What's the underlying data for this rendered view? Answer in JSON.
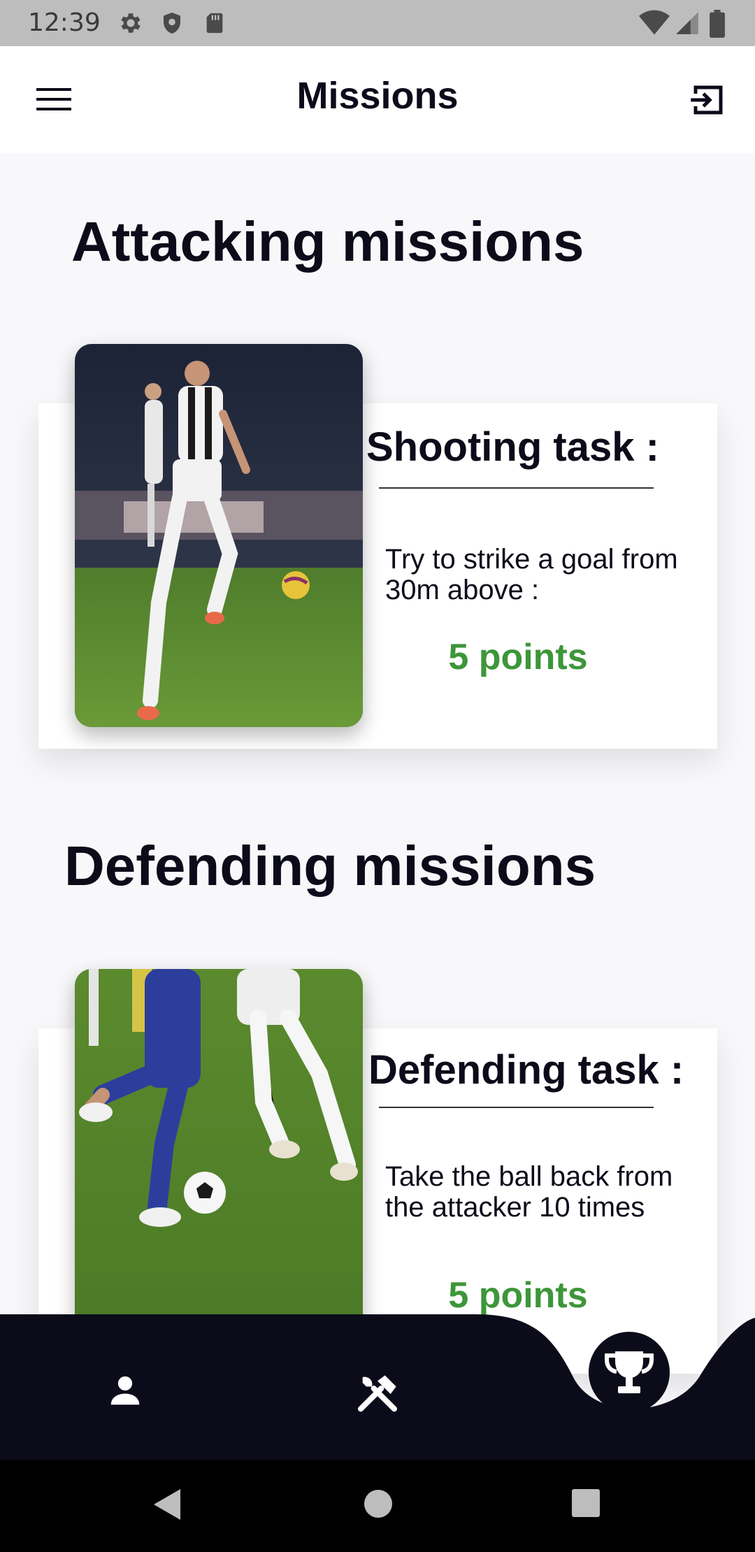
{
  "status_bar": {
    "time": "12:39",
    "icons": [
      "gear-icon",
      "shield-icon",
      "sd-card-icon",
      "wifi-icon",
      "signal-icon",
      "battery-icon"
    ]
  },
  "app_bar": {
    "title": "Missions",
    "menu_icon": "hamburger-menu-icon",
    "logout_icon": "logout-icon"
  },
  "sections": [
    {
      "title": "Attacking missions",
      "card": {
        "image": "football-player-shooting-photo",
        "task_title": "Shooting task :",
        "description": "Try to strike a goal from 30m above :",
        "points": "5 points"
      }
    },
    {
      "title": "Defending missions",
      "card": {
        "image": "football-players-tackling-photo",
        "task_title": "Defending task :",
        "description": "Take the ball back from the attacker 10 times",
        "points": "5 points"
      }
    }
  ],
  "bottom_nav": {
    "items": [
      "profile-icon",
      "tools-icon",
      "trophy-icon"
    ],
    "active": "trophy-icon",
    "bar_color": "#0b0b1a"
  },
  "system_nav": {
    "items": [
      "back-icon",
      "home-icon",
      "recents-icon"
    ]
  },
  "colors": {
    "points": "#3d9639",
    "dark": "#0b0b1a",
    "background": "#f8f8fa"
  }
}
